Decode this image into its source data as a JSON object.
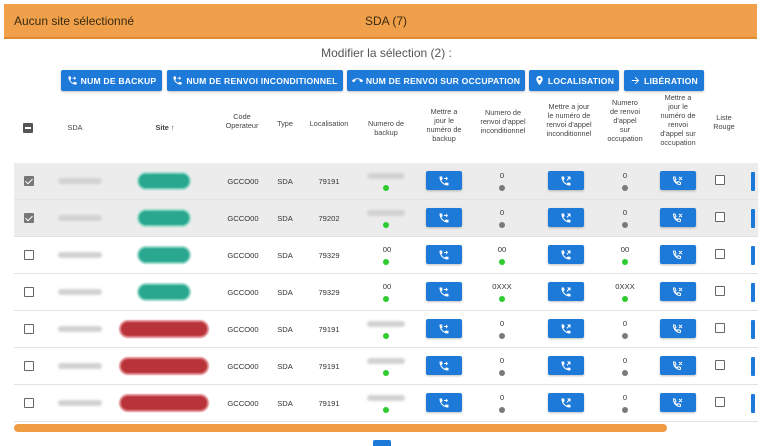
{
  "topbar": {
    "site_status": "Aucun site sélectionné",
    "sda_count": "SDA (7)"
  },
  "selection": {
    "label": "Modifier la sélection (2) :"
  },
  "actions": [
    {
      "label": "NUM DE BACKUP",
      "icon": "phone-forward-icon"
    },
    {
      "label": "NUM DE RENVOI INCONDITIONNEL",
      "icon": "phone-forward-icon"
    },
    {
      "label": "NUM DE RENVOI SUR OCCUPATION",
      "icon": "phone-hangup-icon"
    },
    {
      "label": "LOCALISATION",
      "icon": "location-icon"
    },
    {
      "label": "LIBÉRATION",
      "icon": "arrow-right-icon"
    }
  ],
  "columns": {
    "sda": "SDA",
    "site": "Site",
    "sort_arrow": "↑",
    "code_operateur": [
      "Code",
      "Operateur"
    ],
    "type": "Type",
    "localisation": "Localisation",
    "numero_backup": [
      "Numero de",
      "backup"
    ],
    "maj_backup": [
      "Mettre a",
      "jour le",
      "numéro de",
      "backup"
    ],
    "renvoi_incond": [
      "Numero de",
      "renvoi d'appel",
      "inconditionnel"
    ],
    "maj_renvoi_incond": [
      "Mettre a jour",
      "le numéro de",
      "renvoi d'appel",
      "inconditionnel"
    ],
    "renvoi_occup": [
      "Numero",
      "de renvoi",
      "d'appel",
      "sur",
      "occupation"
    ],
    "maj_renvoi_occup": [
      "Mettre a",
      "jour le",
      "numéro de",
      "renvoi",
      "d'appel sur",
      "occupation"
    ],
    "liste_rouge": [
      "Liste",
      "Rouge"
    ]
  },
  "rows": [
    {
      "selected": true,
      "site_color": "green",
      "code": "GCCO00",
      "type": "SDA",
      "localisation": "79191",
      "backup": "",
      "backup_status": "green",
      "renvoi_incond": "0",
      "incond_status": "grey",
      "renvoi_occup": "0",
      "occup_status": "grey"
    },
    {
      "selected": true,
      "site_color": "green",
      "code": "GCCO00",
      "type": "SDA",
      "localisation": "79202",
      "backup": "",
      "backup_status": "green",
      "renvoi_incond": "0",
      "incond_status": "grey",
      "renvoi_occup": "0",
      "occup_status": "grey"
    },
    {
      "selected": false,
      "site_color": "green",
      "code": "GCCO00",
      "type": "SDA",
      "localisation": "79329",
      "backup": "00",
      "backup_status": "green",
      "renvoi_incond": "00",
      "incond_status": "green",
      "renvoi_occup": "00",
      "occup_status": "green"
    },
    {
      "selected": false,
      "site_color": "green",
      "code": "GCCO00",
      "type": "SDA",
      "localisation": "79329",
      "backup": "00",
      "backup_status": "green",
      "renvoi_incond": "0XXX",
      "incond_status": "green",
      "renvoi_occup": "0XXX",
      "occup_status": "green"
    },
    {
      "selected": false,
      "site_color": "red",
      "code": "GCCO00",
      "type": "SDA",
      "localisation": "79191",
      "backup": "",
      "backup_status": "green",
      "renvoi_incond": "0",
      "incond_status": "grey",
      "renvoi_occup": "0",
      "occup_status": "grey"
    },
    {
      "selected": false,
      "site_color": "red",
      "code": "GCCO00",
      "type": "SDA",
      "localisation": "79191",
      "backup": "",
      "backup_status": "green",
      "renvoi_incond": "0",
      "incond_status": "grey",
      "renvoi_occup": "0",
      "occup_status": "grey"
    },
    {
      "selected": false,
      "site_color": "red",
      "code": "GCCO00",
      "type": "SDA",
      "localisation": "79191",
      "backup": "",
      "backup_status": "green",
      "renvoi_incond": "0",
      "incond_status": "grey",
      "renvoi_occup": "0",
      "occup_status": "grey"
    }
  ],
  "colors": {
    "header_orange": "#f0a04b",
    "primary_blue": "#1e7ad9",
    "site_green": "#2aa88f",
    "site_red": "#b8343a",
    "status_green": "#2ecc2e",
    "status_grey": "#7a7a7a"
  }
}
